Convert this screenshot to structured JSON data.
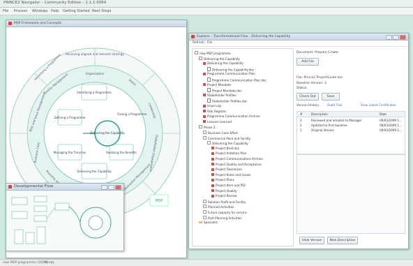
{
  "app": {
    "title": "PRINCE2 Navigator – Community Edition – 1.1.1.0064"
  },
  "menu": [
    "File",
    "Process",
    "Windows",
    "Help",
    "Getting Started",
    "Next Steps"
  ],
  "diagram_window": {
    "title": "MSP Framework and Concepts"
  },
  "diagram": {
    "outer_top": "Receiving aligned and relevant strategy",
    "outer_topleft": "Identifying a Programme",
    "ring_labels": [
      "Organisation",
      "Vision",
      "Leadership",
      "Stakeholder Engagement",
      "Benefits Realisation Management",
      "Blueprint Design and Delivery",
      "Planning and Control",
      "Business Case",
      "Risk and Issue Management",
      "Quality Management"
    ],
    "inner_labels": [
      "Identifying a Programme",
      "Defining a Programme",
      "Managing the Tranches",
      "Delivering the Capability",
      "Realising the Benefits",
      "Closing a Programme"
    ],
    "center": "Delivering the Capability",
    "logo": "MSP"
  },
  "devflow_window": {
    "title": "Developmental Flow"
  },
  "explorer": {
    "title": "Explorer – Transformational Flow – Delivering the Capability",
    "submenu": [
      "Refresh",
      "File"
    ],
    "tree": [
      {
        "label": "new MSP programme",
        "indent": 0,
        "icon": "ex"
      },
      {
        "label": "Delivering the Capability",
        "indent": 1,
        "icon": "ex"
      },
      {
        "label": "Delivering the Capability",
        "indent": 2,
        "icon": "sq"
      },
      {
        "label": "Delivering the Capability.doc",
        "indent": 3,
        "icon": "doc"
      },
      {
        "label": "Programme Communication Plan",
        "indent": 2,
        "icon": "sq"
      },
      {
        "label": "Programme Communication Plan.doc",
        "indent": 3,
        "icon": "doc"
      },
      {
        "label": "Project Mandate",
        "indent": 2,
        "icon": "sq"
      },
      {
        "label": "Project Mandate.doc",
        "indent": 3,
        "icon": "doc"
      },
      {
        "label": "Stakeholder Profiles",
        "indent": 2,
        "icon": "sq"
      },
      {
        "label": "Stakeholder Profiles.doc",
        "indent": 3,
        "icon": "doc"
      },
      {
        "label": "Issue Log",
        "indent": 2,
        "icon": "sq"
      },
      {
        "label": "Risk Register",
        "indent": 2,
        "icon": "sq"
      },
      {
        "label": "Programme Communication Archive",
        "indent": 2,
        "icon": "sq"
      },
      {
        "label": "Lessons Learned",
        "indent": 2,
        "icon": "sq"
      },
      {
        "label": "Phase 2",
        "indent": 1,
        "icon": "ex"
      },
      {
        "label": "Business Case Effort",
        "indent": 2,
        "icon": "ex"
      },
      {
        "label": "Commercial Pace and Facility",
        "indent": 2,
        "icon": "ex"
      },
      {
        "label": "Delivering the Capability",
        "indent": 3,
        "icon": "ex"
      },
      {
        "label": "Project Brief.doc",
        "indent": 4,
        "icon": "sq"
      },
      {
        "label": "Project Initiation Plan",
        "indent": 4,
        "icon": "sq"
      },
      {
        "label": "Project Communications Archive",
        "indent": 4,
        "icon": "sq"
      },
      {
        "label": "Project Quality and Acceptance",
        "indent": 4,
        "icon": "sq"
      },
      {
        "label": "Project Tolerances",
        "indent": 4,
        "icon": "sq"
      },
      {
        "label": "Project Roles and Issues",
        "indent": 4,
        "icon": "sq"
      },
      {
        "label": "Project Plans",
        "indent": 4,
        "icon": "sq"
      },
      {
        "label": "Project Item and PID",
        "indent": 4,
        "icon": "sq"
      },
      {
        "label": "Project Quality",
        "indent": 4,
        "icon": "sq"
      },
      {
        "label": "Project Review",
        "indent": 4,
        "icon": "sq"
      },
      {
        "label": "Solution Profit and Facility",
        "indent": 2,
        "icon": "ex"
      },
      {
        "label": "Planned Activities",
        "indent": 2,
        "icon": "ex"
      },
      {
        "label": "Future capacity for service",
        "indent": 2,
        "icon": "ex"
      },
      {
        "label": "Post Planning Activities",
        "indent": 2,
        "icon": "ex"
      },
      {
        "label": "Specialist",
        "indent": 1,
        "icon": "fold"
      }
    ],
    "right": {
      "doc_label": "Document: Prepare Create",
      "add_file": "Add File",
      "file_label": "File: Prince2 ProjectGuide.doc",
      "version_label": "Baseline Version: 3",
      "status_label": "Status:",
      "check_out": "Check Out",
      "save": "Save",
      "tabs": [
        "Version History",
        "Audit Trail",
        "View Latest Certificates"
      ],
      "columns": [
        "#",
        "Description",
        "Date"
      ],
      "rows": [
        [
          "3",
          "Reviewed and emailed to Manager",
          "09/03/2009 1..."
        ],
        [
          "2",
          "Updated to first baseline",
          "09/03/2009 1..."
        ],
        [
          "1",
          "Original Version",
          "09/03/2009 1..."
        ]
      ],
      "view_version": "View Version",
      "new_description": "New Description"
    }
  },
  "status": {
    "left": "new MSP programme (2009)",
    "right": "Ready"
  }
}
